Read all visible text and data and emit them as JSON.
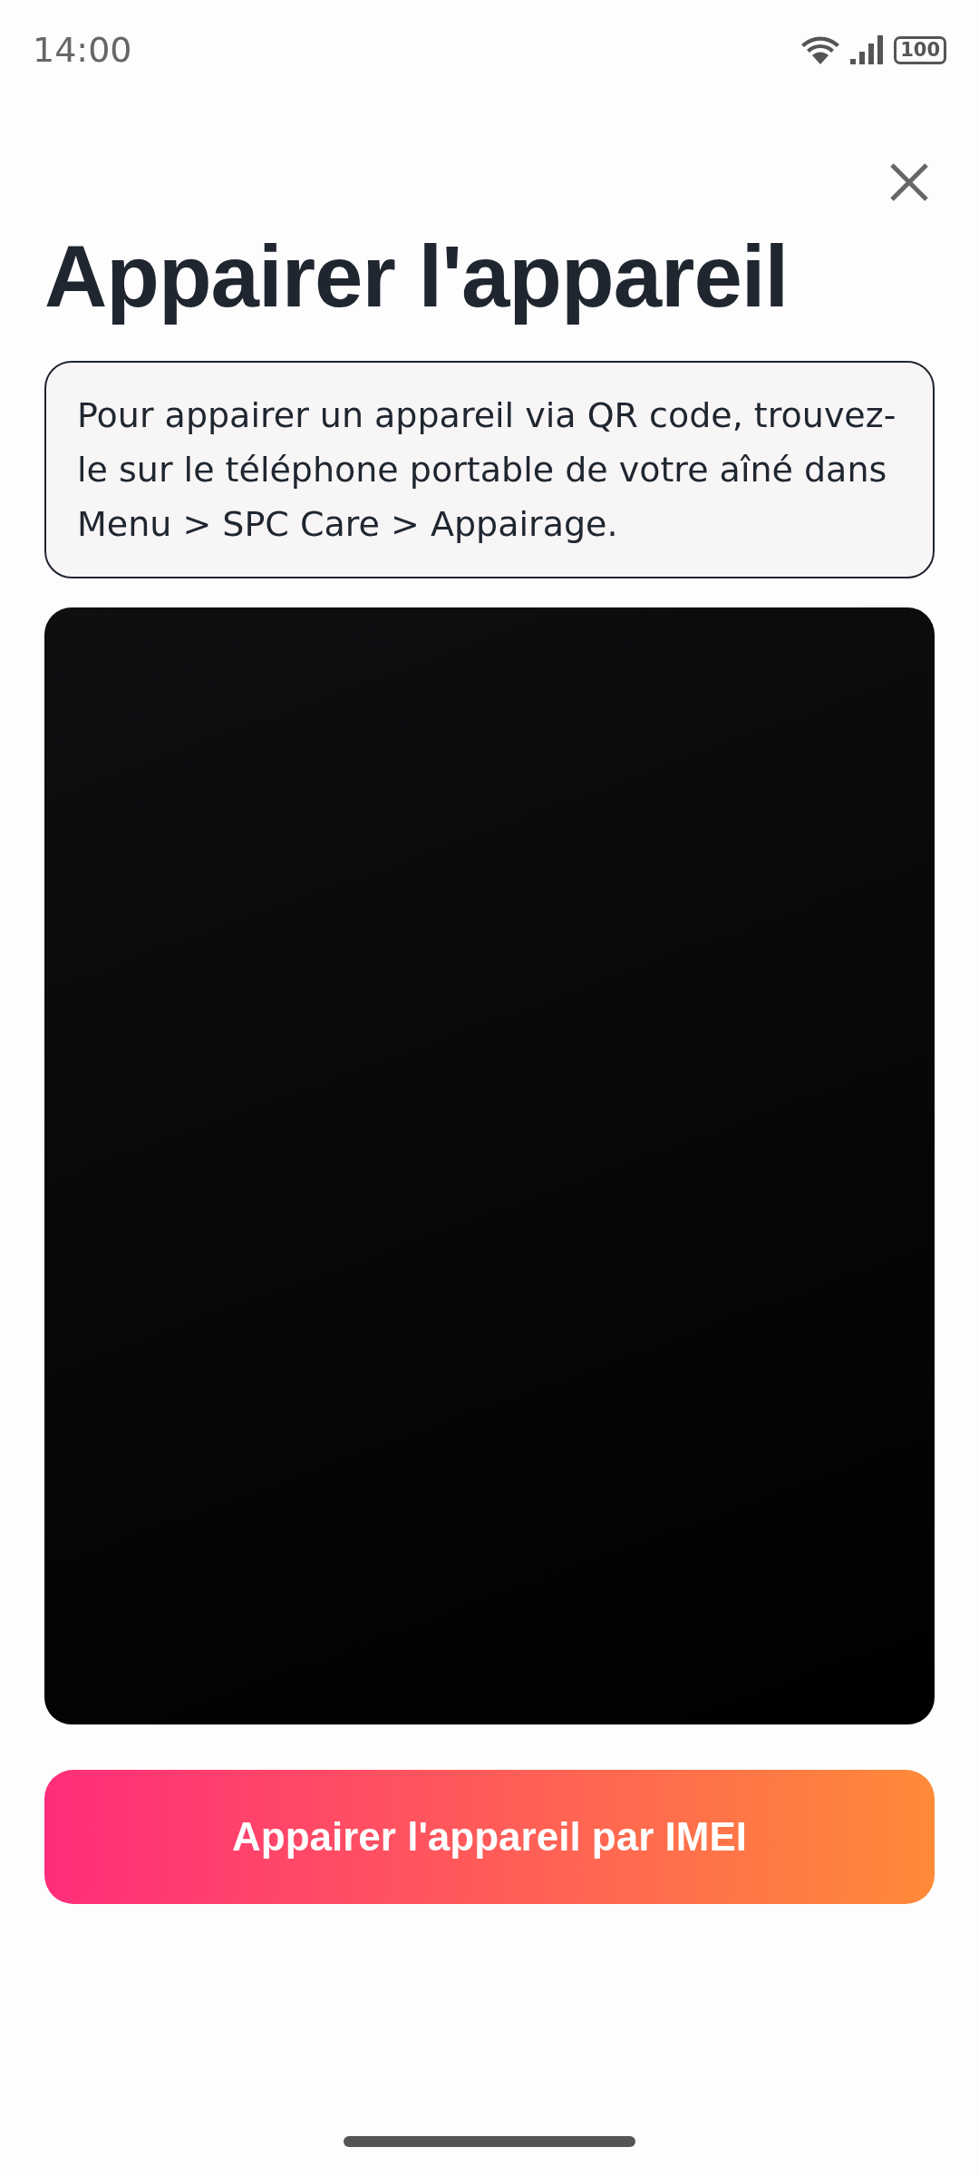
{
  "status_bar": {
    "time": "14:00",
    "battery": "100"
  },
  "title": "Appairer l'appareil",
  "instructions": "Pour appairer un appareil via QR code, trouvez-le sur le téléphone portable de votre aîné dans Menu > SPC Care > Appairage.",
  "button": "Appairer l'appareil par IMEI"
}
